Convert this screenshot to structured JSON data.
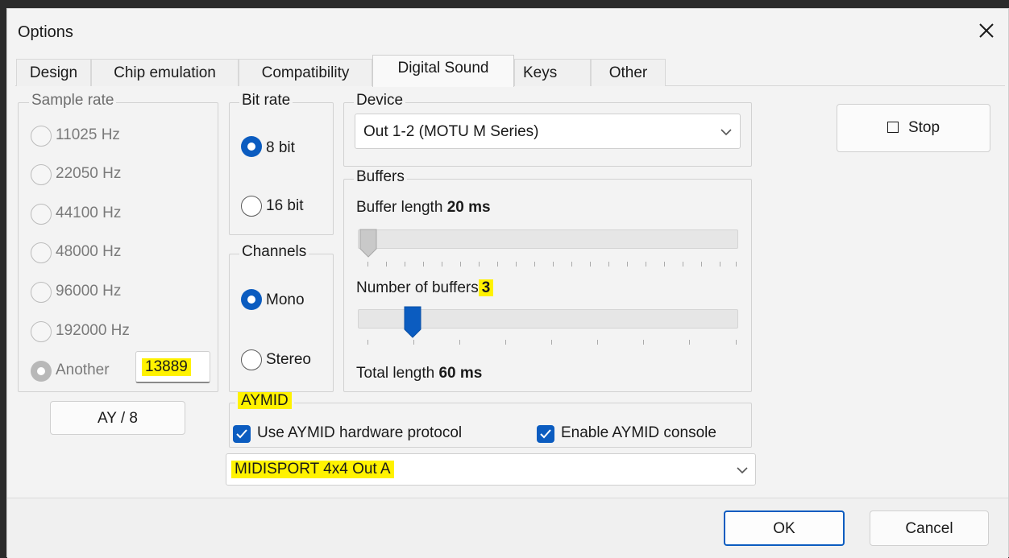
{
  "window": {
    "title": "Options",
    "close_glyph": "✕"
  },
  "tabs": [
    {
      "label": "Design"
    },
    {
      "label": "Chip emulation"
    },
    {
      "label": "Compatibility"
    },
    {
      "label": "Digital Sound",
      "active": true
    },
    {
      "label": "Keys"
    },
    {
      "label": "Other"
    }
  ],
  "sample_rate": {
    "legend": "Sample rate",
    "options": [
      "11025 Hz",
      "22050 Hz",
      "44100 Hz",
      "48000 Hz",
      "96000 Hz",
      "192000 Hz",
      "Another"
    ],
    "selected": "Another",
    "another_value": "13889",
    "ay_button": "AY / 8"
  },
  "bit_rate": {
    "legend": "Bit rate",
    "options": [
      "8 bit",
      "16 bit"
    ],
    "selected": "8 bit"
  },
  "channels": {
    "legend": "Channels",
    "options": [
      "Mono",
      "Stereo"
    ],
    "selected": "Mono"
  },
  "device": {
    "legend": "Device",
    "value": "Out 1-2 (MOTU M Series)"
  },
  "buffers": {
    "legend": "Buffers",
    "length_label": "Buffer length",
    "length_value": "20 ms",
    "count_label": "Number of buffers",
    "count_value": "3",
    "total_label": "Total length",
    "total_value": "60 ms"
  },
  "aymid": {
    "legend": "AYMID",
    "use_protocol_label": "Use AYMID hardware protocol",
    "use_protocol_checked": true,
    "console_label": "Enable AYMID console",
    "console_checked": true,
    "midi_port": "MIDISPORT 4x4 Out A"
  },
  "stop_button": "Stop",
  "ok_button": "OK",
  "cancel_button": "Cancel",
  "colors": {
    "accent": "#0b5cc0",
    "highlight": "#fff200"
  }
}
